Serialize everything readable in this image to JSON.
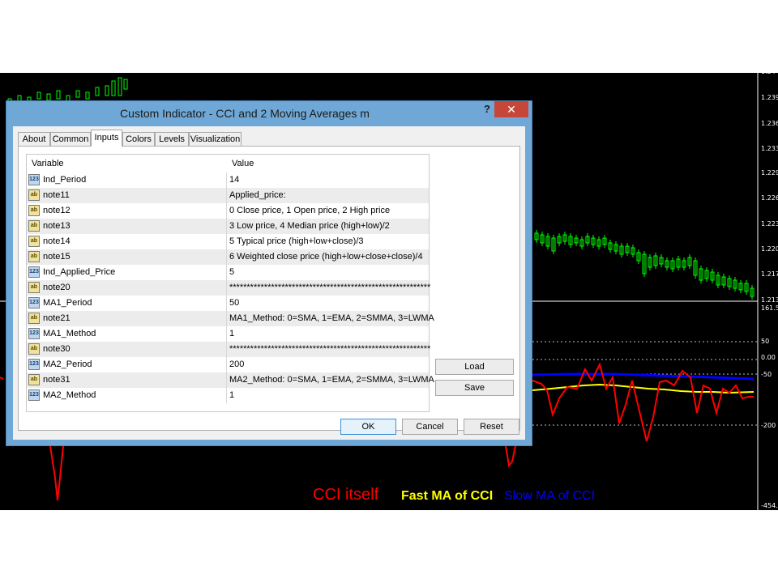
{
  "dialog": {
    "title": "Custom Indicator - CCI and 2 Moving Averages m",
    "help_label": "?",
    "close_label": "✕"
  },
  "tabs": [
    {
      "label": "About"
    },
    {
      "label": "Common"
    },
    {
      "label": "Inputs",
      "active": true
    },
    {
      "label": "Colors"
    },
    {
      "label": "Levels"
    },
    {
      "label": "Visualization"
    }
  ],
  "grid": {
    "headers": {
      "variable": "Variable",
      "value": "Value"
    },
    "rows": [
      {
        "type": "int",
        "icon_text": "123",
        "variable": "Ind_Period",
        "value": "14"
      },
      {
        "type": "str",
        "icon_text": "ab",
        "variable": "note11",
        "value": "Applied_price:"
      },
      {
        "type": "str",
        "icon_text": "ab",
        "variable": "note12",
        "value": "0 Close price, 1 Open price, 2 High price"
      },
      {
        "type": "str",
        "icon_text": "ab",
        "variable": "note13",
        "value": "3 Low price, 4 Median price (high+low)/2"
      },
      {
        "type": "str",
        "icon_text": "ab",
        "variable": "note14",
        "value": "5 Typical price (high+low+close)/3"
      },
      {
        "type": "str",
        "icon_text": "ab",
        "variable": "note15",
        "value": "6 Weighted close price (high+low+close+close)/4"
      },
      {
        "type": "int",
        "icon_text": "123",
        "variable": "Ind_Applied_Price",
        "value": "5"
      },
      {
        "type": "str",
        "icon_text": "ab",
        "variable": "note20",
        "value": "**********************************************************"
      },
      {
        "type": "int",
        "icon_text": "123",
        "variable": "MA1_Period",
        "value": "50"
      },
      {
        "type": "str",
        "icon_text": "ab",
        "variable": "note21",
        "value": "MA1_Method: 0=SMA, 1=EMA, 2=SMMA, 3=LWMA"
      },
      {
        "type": "int",
        "icon_text": "123",
        "variable": "MA1_Method",
        "value": "1"
      },
      {
        "type": "str",
        "icon_text": "ab",
        "variable": "note30",
        "value": "**********************************************************"
      },
      {
        "type": "int",
        "icon_text": "123",
        "variable": "MA2_Period",
        "value": "200"
      },
      {
        "type": "str",
        "icon_text": "ab",
        "variable": "note31",
        "value": "MA2_Method: 0=SMA, 1=EMA, 2=SMMA, 3=LWMA"
      },
      {
        "type": "int",
        "icon_text": "123",
        "variable": "MA2_Method",
        "value": "1"
      }
    ]
  },
  "buttons": {
    "load": "Load",
    "save": "Save",
    "ok": "OK",
    "cancel": "Cancel",
    "reset": "Reset"
  },
  "chart": {
    "price_labels": [
      "1.24",
      "1.239",
      "1.236",
      "1.233",
      "1.229",
      "1.226",
      "1.223",
      "1.220",
      "1.217",
      "1.213"
    ],
    "indicator_labels": [
      "161.5",
      "50",
      "0.00",
      "-50",
      "-200",
      "-454.1"
    ],
    "captions": [
      {
        "text": "CCI itself",
        "color": "#ff0000"
      },
      {
        "text": "Fast MA of CCI",
        "color": "#ffff00"
      },
      {
        "text": "Slow MA of CCI",
        "color": "#0000ff"
      }
    ],
    "colors": {
      "candle": "#00ff00",
      "cci": "#ff0000",
      "fast_ma": "#ffff00",
      "slow_ma": "#0000ff"
    }
  }
}
